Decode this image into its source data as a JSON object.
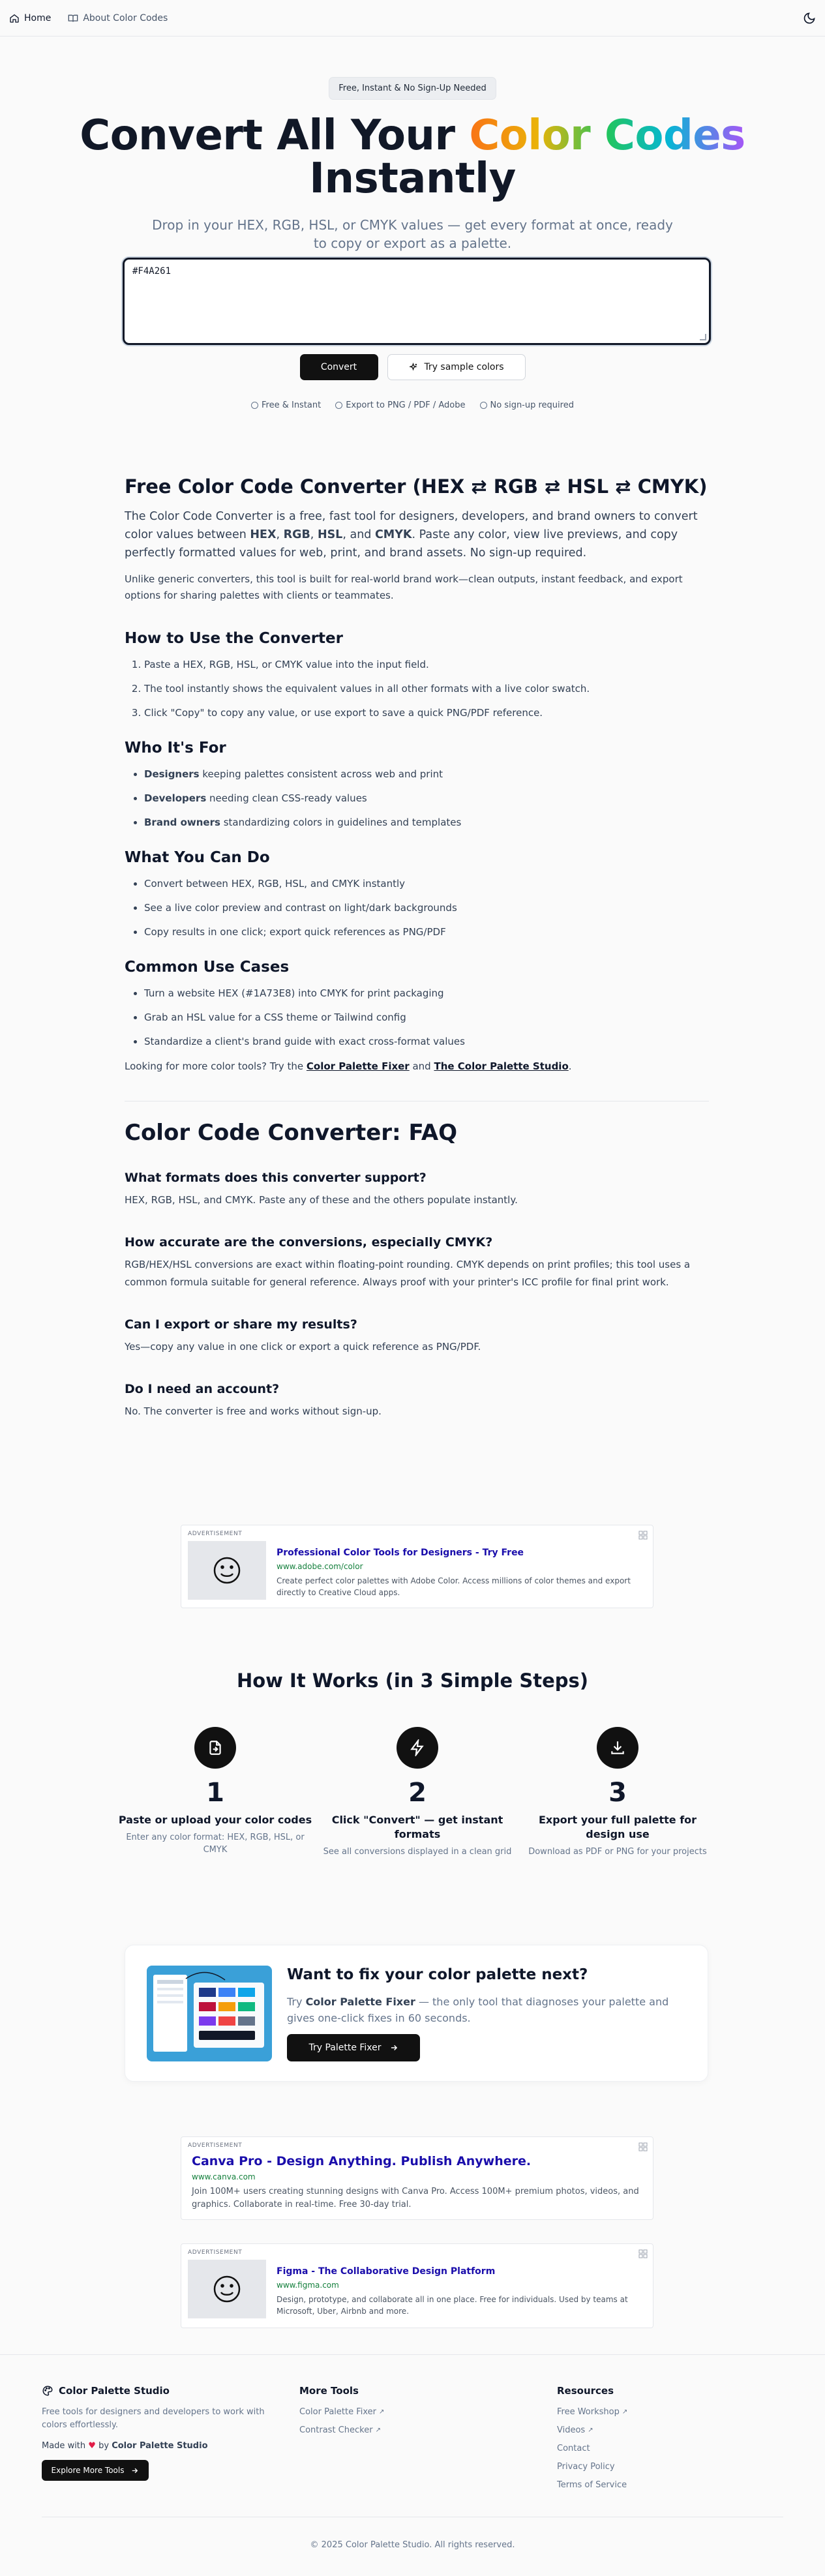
{
  "nav": {
    "home": "Home",
    "about": "About Color Codes"
  },
  "hero": {
    "badge": "Free, Instant & No Sign-Up Needed",
    "title_pre": "Convert All Your ",
    "title_color": "Color Codes",
    "title_post": "Instantly",
    "subtitle": "Drop in your HEX, RGB, HSL, or CMYK values — get every format at once, ready to copy or export as a palette."
  },
  "converter": {
    "input_value": "#F4A261",
    "convert_button": "Convert",
    "sample_button": "Try sample colors",
    "features": [
      "Free & Instant",
      "Export to PNG / PDF / Adobe",
      "No sign-up required"
    ]
  },
  "article": {
    "title": "Free Color Code Converter (HEX ⇄ RGB ⇄ HSL ⇄ CMYK)",
    "lead_pre": "The Color Code Converter is a free, fast tool for designers, developers, and brand owners to convert color values between ",
    "lead_hex": "HEX",
    "lead_sep1": ", ",
    "lead_rgb": "RGB",
    "lead_sep2": ", ",
    "lead_hsl": "HSL",
    "lead_sep3": ", and ",
    "lead_cmyk": "CMYK",
    "lead_post": ". Paste any color, view live previews, and copy perfectly formatted values for web, print, and brand assets. No sign-up required.",
    "intro2": "Unlike generic converters, this tool is built for real-world brand work—clean outputs, instant feedback, and export options for sharing palettes with clients or teammates.",
    "howto_title": "How to Use the Converter",
    "howto_steps": [
      "Paste a HEX, RGB, HSL, or CMYK value into the input field.",
      "The tool instantly shows the equivalent values in all other formats with a live color swatch.",
      "Click \"Copy\" to copy any value, or use export to save a quick PNG/PDF reference."
    ],
    "who_title": "Who It's For",
    "who_items": [
      {
        "bold": "Designers",
        "rest": " keeping palettes consistent across web and print"
      },
      {
        "bold": "Developers",
        "rest": " needing clean CSS-ready values"
      },
      {
        "bold": "Brand owners",
        "rest": " standardizing colors in guidelines and templates"
      }
    ],
    "can_title": "What You Can Do",
    "can_items": [
      "Convert between HEX, RGB, HSL, and CMYK instantly",
      "See a live color preview and contrast on light/dark backgrounds",
      "Copy results in one click; export quick references as PNG/PDF"
    ],
    "uses_title": "Common Use Cases",
    "uses_items": [
      "Turn a website HEX (#1A73E8) into CMYK for print packaging",
      "Grab an HSL value for a CSS theme or Tailwind config",
      "Standardize a client's brand guide with exact cross-format values"
    ],
    "more_pre": "Looking for more color tools? Try the ",
    "more_link1": "Color Palette Fixer",
    "more_mid": " and ",
    "more_link2": "The Color Palette Studio",
    "more_post": "."
  },
  "faq": {
    "title": "Color Code Converter: FAQ",
    "items": [
      {
        "q": "What formats does this converter support?",
        "a": "HEX, RGB, HSL, and CMYK. Paste any of these and the others populate instantly."
      },
      {
        "q": "How accurate are the conversions, especially CMYK?",
        "a": "RGB/HEX/HSL conversions are exact within floating-point rounding. CMYK depends on print profiles; this tool uses a common formula suitable for general reference. Always proof with your printer's ICC profile for final print work."
      },
      {
        "q": "Can I export or share my results?",
        "a": "Yes—copy any value in one click or export a quick reference as PNG/PDF."
      },
      {
        "q": "Do I need an account?",
        "a": "No. The converter is free and works without sign-up."
      }
    ]
  },
  "ads": [
    {
      "label": "ADVERTISEMENT",
      "title": "Professional Color Tools for Designers - Try Free",
      "url": "www.adobe.com/color",
      "desc": "Create perfect color palettes with Adobe Color. Access millions of color themes and export directly to Creative Cloud apps."
    },
    {
      "label": "ADVERTISEMENT",
      "title": "Canva Pro - Design Anything. Publish Anywhere.",
      "url": "www.canva.com",
      "desc": "Join 100M+ users creating stunning designs with Canva Pro. Access 100M+ premium photos, videos, and graphics. Collaborate in real-time. Free 30-day trial."
    },
    {
      "label": "ADVERTISEMENT",
      "title": "Figma - The Collaborative Design Platform",
      "url": "www.figma.com",
      "desc": "Design, prototype, and collaborate all in one place. Free for individuals. Used by teams at Microsoft, Uber, Airbnb and more."
    }
  ],
  "how": {
    "title": "How It Works (in 3 Simple Steps)",
    "steps": [
      {
        "num": "1",
        "title": "Paste or upload your color codes",
        "desc": "Enter any color format: HEX, RGB, HSL, or CMYK"
      },
      {
        "num": "2",
        "title": "Click \"Convert\" — get instant formats",
        "desc": "See all conversions displayed in a clean grid"
      },
      {
        "num": "3",
        "title": "Export your full palette for design use",
        "desc": "Download as PDF or PNG for your projects"
      }
    ]
  },
  "promo": {
    "title": "Want to fix your color palette next?",
    "desc_pre": "Try ",
    "desc_bold": "Color Palette Fixer",
    "desc_post": " — the only tool that diagnoses your palette and gives one-click fixes in 60 seconds.",
    "button": "Try Palette Fixer"
  },
  "footer": {
    "brand": "Color Palette Studio",
    "desc": "Free tools for designers and developers to work with colors effortlessly.",
    "made_pre": "Made with",
    "made_by": "by",
    "made_brand": "Color Palette Studio",
    "explore": "Explore More Tools",
    "more_title": "More Tools",
    "more_links": [
      "Color Palette Fixer",
      "Contrast Checker"
    ],
    "res_title": "Resources",
    "res_links": [
      "Free Workshop",
      "Videos",
      "Contact",
      "Privacy Policy",
      "Terms of Service"
    ],
    "copyright": "© 2025 Color Palette Studio. All rights reserved."
  },
  "colors": {
    "accent": "#111111",
    "ad_title": "#1a0dab",
    "ad_url": "#15803d",
    "heart": "#e11d48"
  }
}
